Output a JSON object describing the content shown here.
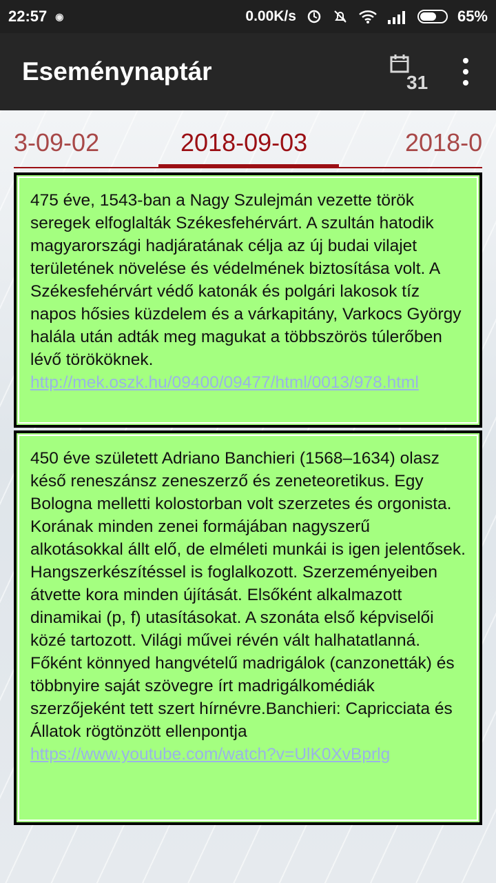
{
  "status_bar": {
    "time": "22:57",
    "network_speed": "0.00K/s",
    "battery_percent": "65%",
    "battery_level": 0.65
  },
  "app_bar": {
    "title": "Eseménynaptár",
    "calendar_icon_number": "31",
    "menu_icon": "more-vert-icon"
  },
  "tabs": {
    "prev": "3-09-02",
    "current": "2018-09-03",
    "next": "2018-0"
  },
  "cards": [
    {
      "text": "475 éve, 1543-ban a Nagy Szulejmán vezette török seregek elfoglalták Székesfehérvárt. A szultán hatodik magyarországi hadjáratának célja az új budai vilajet területének növelése és védelmének biztosítása volt. A Székesfehérvárt védő katonák és polgári lakosok tíz napos hősies küzdelem és a várkapitány, Varkocs György halála után adták meg magukat a többszörös túlerőben lévő törököknek.",
      "link": "http://mek.oszk.hu/09400/09477/html/0013/978.html"
    },
    {
      "text": "450 éve született Adriano Banchieri (1568–1634) olasz késő reneszánsz zeneszerző és zeneteoretikus. Egy Bologna melletti kolostorban volt szerzetes és orgonista. Korának minden zenei formájában nagyszerű alkotásokkal állt elő, de elméleti munkái is igen jelentősek. Hangszerkészítéssel is foglalkozott. Szerzeményeiben átvette kora minden újítását. Elsőként alkalmazott dinamikai (p, f) utasításokat. A szonáta első képviselői közé tartozott. Világi művei révén vált halhatatlanná. Főként könnyed hangvételű madrigálok (canzonetták) és többnyire saját szövegre írt madrigálkomédiák szerzőjeként tett szert hírnévre.Banchieri: Capricciata és Állatok rögtönzött ellenpontja",
      "link": "https://www.youtube.com/watch?v=UlK0XvBprlg"
    }
  ],
  "colors": {
    "card_background": "#a4ff80",
    "accent": "#9b0f14",
    "link": "#9ab4e6",
    "toolbar": "#262626"
  }
}
